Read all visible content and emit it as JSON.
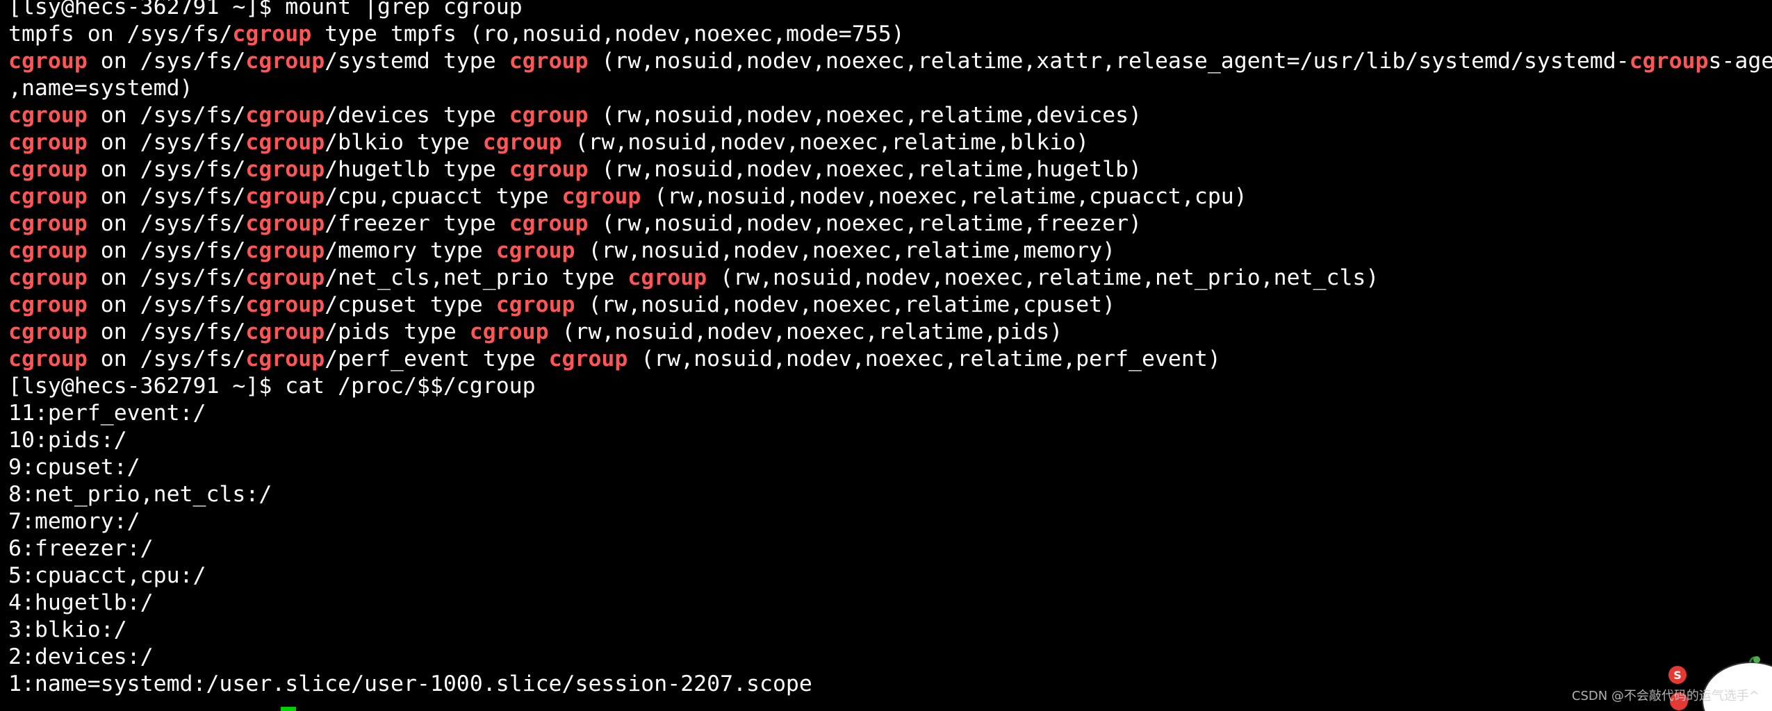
{
  "terminal": {
    "background": "#000000",
    "foreground": "#ffffff",
    "highlight_color": "#ff5555",
    "cursor_color": "#00d000",
    "lines": [
      {
        "kind": "plain",
        "text": "[lsy@hecs-362791 ~]$ mount |grep cgroup"
      },
      {
        "kind": "mount",
        "fs": "tmpfs",
        "target_pre": "/sys/fs/",
        "target_post": "",
        "type": "tmpfs",
        "opts": "(ro,nosuid,nodev,noexec,mode=755)"
      },
      {
        "kind": "systemd",
        "fs": "cgroup",
        "target_pre": "/sys/fs/",
        "target_post": "/systemd",
        "type": "cgroup",
        "opts_pre": "(rw,nosuid,nodev,noexec,relatime,xattr,release_agent=/usr/lib/systemd/systemd-",
        "opts_post": "s-age"
      },
      {
        "kind": "plain",
        "text": ",name=systemd)"
      },
      {
        "kind": "mount",
        "fs": "cgroup",
        "target_pre": "/sys/fs/",
        "target_post": "/devices",
        "type": "cgroup",
        "opts": "(rw,nosuid,nodev,noexec,relatime,devices)"
      },
      {
        "kind": "mount",
        "fs": "cgroup",
        "target_pre": "/sys/fs/",
        "target_post": "/blkio",
        "type": "cgroup",
        "opts": "(rw,nosuid,nodev,noexec,relatime,blkio)"
      },
      {
        "kind": "mount",
        "fs": "cgroup",
        "target_pre": "/sys/fs/",
        "target_post": "/hugetlb",
        "type": "cgroup",
        "opts": "(rw,nosuid,nodev,noexec,relatime,hugetlb)"
      },
      {
        "kind": "mount",
        "fs": "cgroup",
        "target_pre": "/sys/fs/",
        "target_post": "/cpu,cpuacct",
        "type": "cgroup",
        "opts": "(rw,nosuid,nodev,noexec,relatime,cpuacct,cpu)"
      },
      {
        "kind": "mount",
        "fs": "cgroup",
        "target_pre": "/sys/fs/",
        "target_post": "/freezer",
        "type": "cgroup",
        "opts": "(rw,nosuid,nodev,noexec,relatime,freezer)"
      },
      {
        "kind": "mount",
        "fs": "cgroup",
        "target_pre": "/sys/fs/",
        "target_post": "/memory",
        "type": "cgroup",
        "opts": "(rw,nosuid,nodev,noexec,relatime,memory)"
      },
      {
        "kind": "mount",
        "fs": "cgroup",
        "target_pre": "/sys/fs/",
        "target_post": "/net_cls,net_prio",
        "type": "cgroup",
        "opts": "(rw,nosuid,nodev,noexec,relatime,net_prio,net_cls)"
      },
      {
        "kind": "mount",
        "fs": "cgroup",
        "target_pre": "/sys/fs/",
        "target_post": "/cpuset",
        "type": "cgroup",
        "opts": "(rw,nosuid,nodev,noexec,relatime,cpuset)"
      },
      {
        "kind": "mount",
        "fs": "cgroup",
        "target_pre": "/sys/fs/",
        "target_post": "/pids",
        "type": "cgroup",
        "opts": "(rw,nosuid,nodev,noexec,relatime,pids)"
      },
      {
        "kind": "mount",
        "fs": "cgroup",
        "target_pre": "/sys/fs/",
        "target_post": "/perf_event",
        "type": "cgroup",
        "opts": "(rw,nosuid,nodev,noexec,relatime,perf_event)"
      },
      {
        "kind": "plain",
        "text": "[lsy@hecs-362791 ~]$ cat /proc/$$/cgroup"
      },
      {
        "kind": "plain",
        "text": "11:perf_event:/"
      },
      {
        "kind": "plain",
        "text": "10:pids:/"
      },
      {
        "kind": "plain",
        "text": "9:cpuset:/"
      },
      {
        "kind": "plain",
        "text": "8:net_prio,net_cls:/"
      },
      {
        "kind": "plain",
        "text": "7:memory:/"
      },
      {
        "kind": "plain",
        "text": "6:freezer:/"
      },
      {
        "kind": "plain",
        "text": "5:cpuacct,cpu:/"
      },
      {
        "kind": "plain",
        "text": "4:hugetlb:/"
      },
      {
        "kind": "plain",
        "text": "3:blkio:/"
      },
      {
        "kind": "plain",
        "text": "2:devices:/"
      },
      {
        "kind": "plain",
        "text": "1:name=systemd:/user.slice/user-1000.slice/session-2207.scope"
      }
    ],
    "highlight_word": "cgroup",
    "word_on": "on",
    "word_type": "type"
  },
  "watermark": {
    "text": "CSDN @不会敲代码的运气选手^"
  },
  "mascot": {
    "icon": "cartoon-mascot-icon",
    "badge_glyph": "S"
  }
}
